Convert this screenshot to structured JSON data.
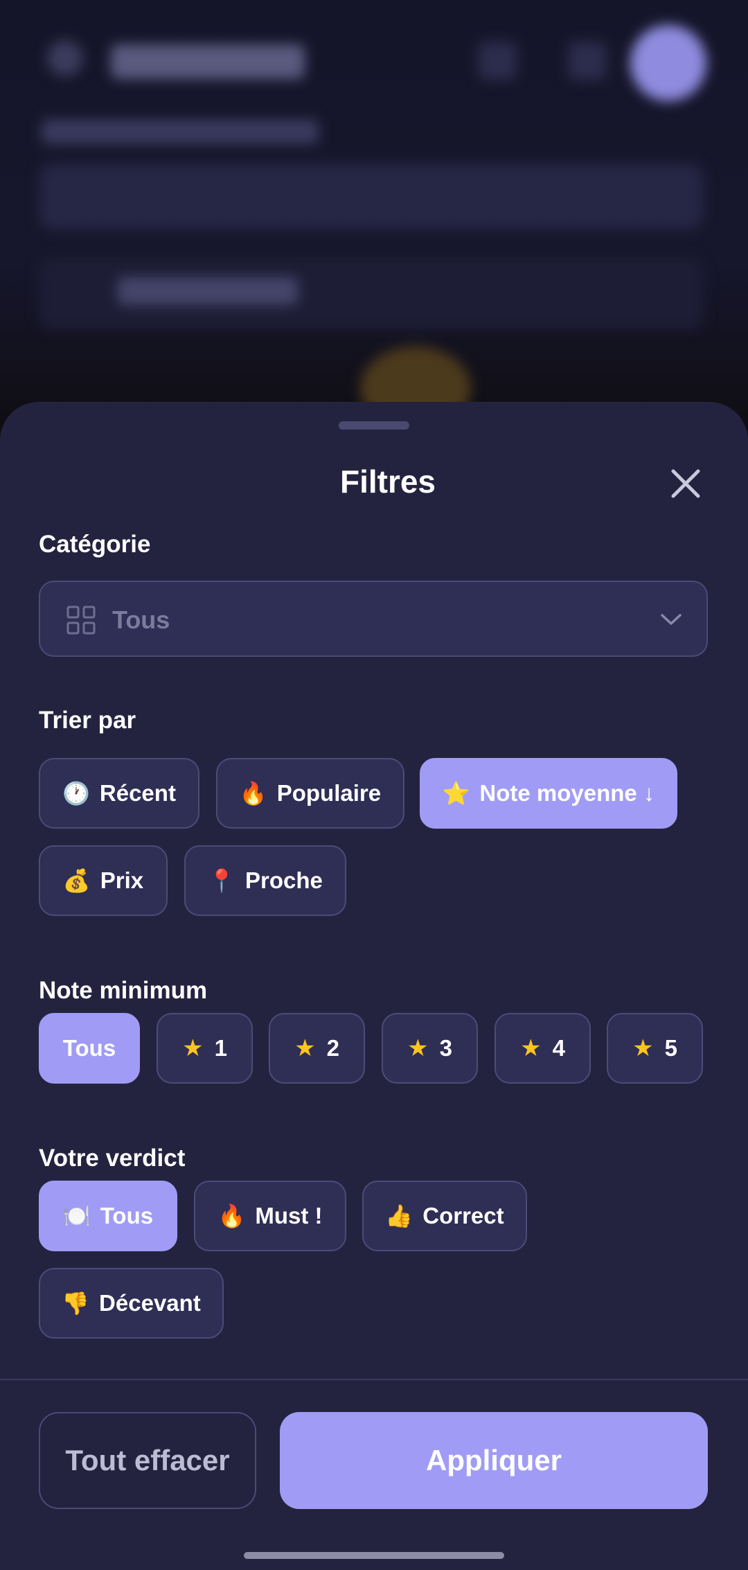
{
  "colors": {
    "sheet_bg": "#24233f",
    "chip_bg": "#2f2e55",
    "chip_border": "#4c4b7a",
    "accent": "#a09cf5",
    "star": "#ffc420",
    "muted_text": "#7c7b9c"
  },
  "sheet": {
    "title": "Filtres",
    "close_icon": "close-icon"
  },
  "category": {
    "label": "Catégorie",
    "icon": "grid-icon",
    "selected": "Tous",
    "chevron_icon": "chevron-down-icon"
  },
  "sort": {
    "label": "Trier par",
    "options": [
      {
        "emoji": "🕐",
        "label": "Récent",
        "active": false
      },
      {
        "emoji": "🔥",
        "label": "Populaire",
        "active": false
      },
      {
        "emoji": "⭐",
        "label": "Note moyenne ↓",
        "active": true
      },
      {
        "emoji": "💰",
        "label": "Prix",
        "active": false
      },
      {
        "emoji": "📍",
        "label": "Proche",
        "active": false
      }
    ]
  },
  "min_rating": {
    "label": "Note minimum",
    "options": [
      {
        "star": "",
        "label": "Tous",
        "active": true
      },
      {
        "star": "★",
        "label": "1",
        "active": false
      },
      {
        "star": "★",
        "label": "2",
        "active": false
      },
      {
        "star": "★",
        "label": "3",
        "active": false
      },
      {
        "star": "★",
        "label": "4",
        "active": false
      },
      {
        "star": "★",
        "label": "5",
        "active": false
      }
    ]
  },
  "verdict": {
    "label": "Votre verdict",
    "options": [
      {
        "emoji": "🍽️",
        "label": "Tous",
        "active": true
      },
      {
        "emoji": "🔥",
        "label": "Must !",
        "active": false
      },
      {
        "emoji": "👍",
        "label": "Correct",
        "active": false
      },
      {
        "emoji": "👎",
        "label": "Décevant",
        "active": false
      }
    ]
  },
  "footer": {
    "clear_label": "Tout effacer",
    "apply_label": "Appliquer"
  }
}
